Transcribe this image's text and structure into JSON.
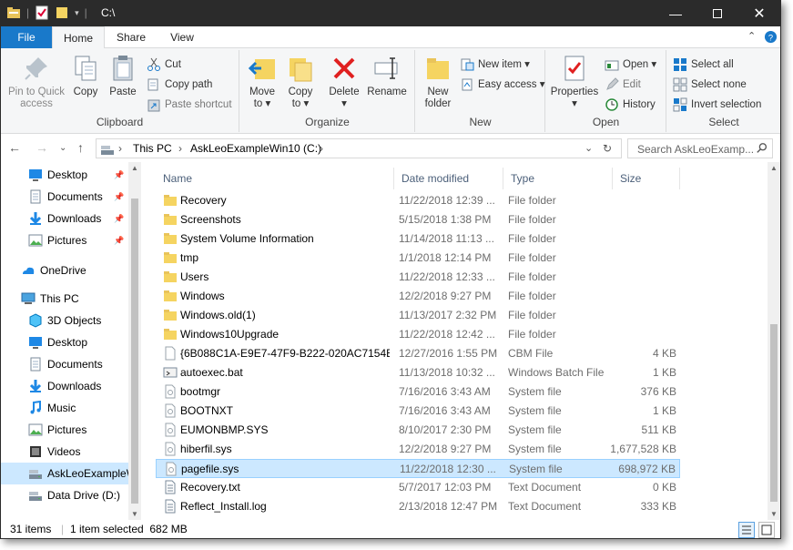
{
  "window": {
    "title": "C:\\",
    "controls": [
      "minimize",
      "maximize",
      "close"
    ]
  },
  "ribbon_tabs": [
    "File",
    "Home",
    "Share",
    "View"
  ],
  "ribbon": {
    "clipboard": {
      "label": "Clipboard",
      "pin": [
        "Pin to Quick",
        "access"
      ],
      "copy": "Copy",
      "paste": "Paste",
      "cut": "Cut",
      "copy_path": "Copy path",
      "paste_shortcut": "Paste shortcut"
    },
    "organize": {
      "label": "Organize",
      "move_to": [
        "Move",
        "to ▾"
      ],
      "copy_to": [
        "Copy",
        "to ▾"
      ],
      "delete": [
        "Delete",
        "▾"
      ],
      "rename": "Rename"
    },
    "new": {
      "label": "New",
      "new_folder": [
        "New",
        "folder"
      ],
      "new_item": "New item ▾",
      "easy_access": "Easy access ▾"
    },
    "open": {
      "label": "Open",
      "properties": [
        "Properties",
        "▾"
      ],
      "open": "Open ▾",
      "edit": "Edit",
      "history": "History"
    },
    "select": {
      "label": "Select",
      "select_all": "Select all",
      "select_none": "Select none",
      "invert_selection": "Invert selection"
    }
  },
  "address": {
    "crumbs": [
      "This PC",
      "AskLeoExampleWin10 (C:)"
    ],
    "search_placeholder": "Search AskLeoExamp..."
  },
  "nav": [
    {
      "label": "Desktop",
      "icon": "desktop-icon",
      "pinned": true
    },
    {
      "label": "Documents",
      "icon": "documents-icon",
      "pinned": true
    },
    {
      "label": "Downloads",
      "icon": "downloads-icon",
      "pinned": true
    },
    {
      "label": "Pictures",
      "icon": "pictures-icon",
      "pinned": true
    },
    {
      "label": "OneDrive",
      "icon": "onedrive-icon",
      "pinned": false
    },
    {
      "label": "This PC",
      "icon": "this-pc-icon",
      "pinned": false
    },
    {
      "label": "3D Objects",
      "icon": "3d-objects-icon",
      "pinned": false
    },
    {
      "label": "Desktop",
      "icon": "desktop-icon",
      "pinned": false
    },
    {
      "label": "Documents",
      "icon": "documents-icon",
      "pinned": false
    },
    {
      "label": "Downloads",
      "icon": "downloads-icon",
      "pinned": false
    },
    {
      "label": "Music",
      "icon": "music-icon",
      "pinned": false
    },
    {
      "label": "Pictures",
      "icon": "pictures-icon",
      "pinned": false
    },
    {
      "label": "Videos",
      "icon": "videos-icon",
      "pinned": false
    },
    {
      "label": "AskLeoExampleW",
      "icon": "drive-icon",
      "pinned": false,
      "selected": true
    },
    {
      "label": "Data Drive (D:)",
      "icon": "drive-icon",
      "pinned": false
    }
  ],
  "columns": [
    "Name",
    "Date modified",
    "Type",
    "Size"
  ],
  "files": [
    {
      "name": "Recovery",
      "date": "11/22/2018 12:39 ...",
      "type": "File folder",
      "size": "",
      "icon": "folder-icon"
    },
    {
      "name": "Screenshots",
      "date": "5/15/2018 1:38 PM",
      "type": "File folder",
      "size": "",
      "icon": "folder-icon"
    },
    {
      "name": "System Volume Information",
      "date": "11/14/2018 11:13 ...",
      "type": "File folder",
      "size": "",
      "icon": "folder-icon"
    },
    {
      "name": "tmp",
      "date": "1/1/2018 12:14 PM",
      "type": "File folder",
      "size": "",
      "icon": "folder-icon"
    },
    {
      "name": "Users",
      "date": "11/22/2018 12:33 ...",
      "type": "File folder",
      "size": "",
      "icon": "folder-icon"
    },
    {
      "name": "Windows",
      "date": "12/2/2018 9:27 PM",
      "type": "File folder",
      "size": "",
      "icon": "folder-icon"
    },
    {
      "name": "Windows.old(1)",
      "date": "11/13/2017 2:32 PM",
      "type": "File folder",
      "size": "",
      "icon": "folder-icon"
    },
    {
      "name": "Windows10Upgrade",
      "date": "11/22/2018 12:42 ...",
      "type": "File folder",
      "size": "",
      "icon": "folder-icon"
    },
    {
      "name": "{6B088C1A-E9E7-47F9-B222-020AC7154B...",
      "date": "12/27/2016 1:55 PM",
      "type": "CBM File",
      "size": "4 KB",
      "icon": "file-icon"
    },
    {
      "name": "autoexec.bat",
      "date": "11/13/2018 10:32 ...",
      "type": "Windows Batch File",
      "size": "1 KB",
      "icon": "batch-file-icon"
    },
    {
      "name": "bootmgr",
      "date": "7/16/2016 3:43 AM",
      "type": "System file",
      "size": "376 KB",
      "icon": "system-file-icon"
    },
    {
      "name": "BOOTNXT",
      "date": "7/16/2016 3:43 AM",
      "type": "System file",
      "size": "1 KB",
      "icon": "system-file-icon"
    },
    {
      "name": "EUMONBMP.SYS",
      "date": "8/10/2017 2:30 PM",
      "type": "System file",
      "size": "511 KB",
      "icon": "system-file-icon"
    },
    {
      "name": "hiberfil.sys",
      "date": "12/2/2018 9:27 PM",
      "type": "System file",
      "size": "1,677,528 KB",
      "icon": "system-file-icon"
    },
    {
      "name": "pagefile.sys",
      "date": "11/22/2018 12:30 ...",
      "type": "System file",
      "size": "698,972 KB",
      "icon": "system-file-icon",
      "selected": true
    },
    {
      "name": "Recovery.txt",
      "date": "5/7/2017 12:03 PM",
      "type": "Text Document",
      "size": "0 KB",
      "icon": "text-file-icon"
    },
    {
      "name": "Reflect_Install.log",
      "date": "2/13/2018 12:47 PM",
      "type": "Text Document",
      "size": "333 KB",
      "icon": "text-file-icon"
    }
  ],
  "status": {
    "count": "31 items",
    "selection": "1 item selected  682 MB"
  }
}
